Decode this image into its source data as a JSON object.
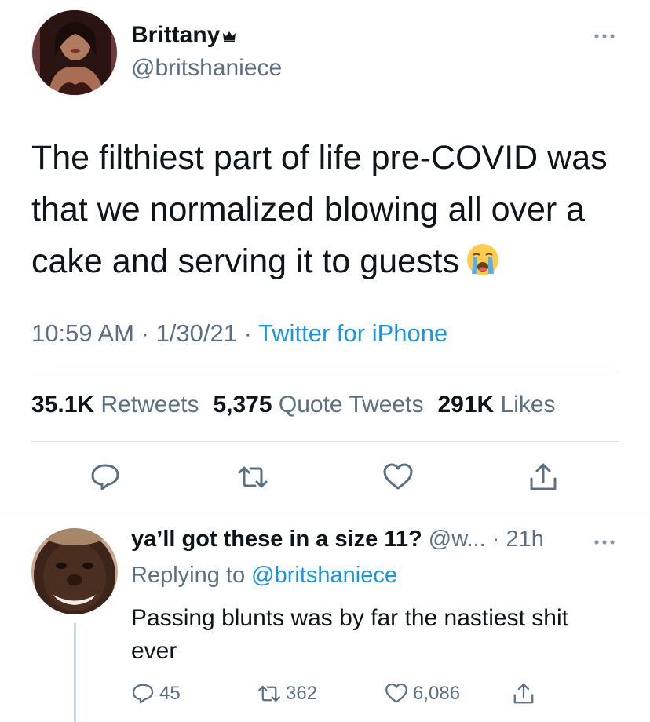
{
  "tweet": {
    "author_name": "Brittany",
    "author_handle": "@britshaniece",
    "text": "The filthiest part of life pre-COVID was that we normalized blowing all over a cake and serving it to guests",
    "time": "10:59 AM",
    "date": "1/30/21",
    "separator": "·",
    "source": "Twitter for iPhone",
    "stats": {
      "retweets_count": "35.1K",
      "retweets_label": "Retweets",
      "quotes_count": "5,375",
      "quotes_label": "Quote Tweets",
      "likes_count": "291K",
      "likes_label": "Likes"
    },
    "icons": {
      "badge": "crown-icon",
      "emoji": "loudly-crying-face-icon",
      "actions": [
        "reply-icon",
        "retweet-icon",
        "like-icon",
        "share-icon"
      ]
    }
  },
  "reply": {
    "author_name": "ya’ll got these in a size 11?",
    "author_handle": "@w...",
    "time": "· 21h",
    "replying_prefix": "Replying to",
    "replying_handle": "@britshaniece",
    "text": "Passing blunts was by far the nastiest shit ever",
    "counts": {
      "replies": "45",
      "retweets": "362",
      "likes": "6,086"
    }
  },
  "colors": {
    "text": "#0f1419",
    "secondary": "#5b7083",
    "link": "#1b95e0",
    "divider": "#dbe2e8"
  }
}
